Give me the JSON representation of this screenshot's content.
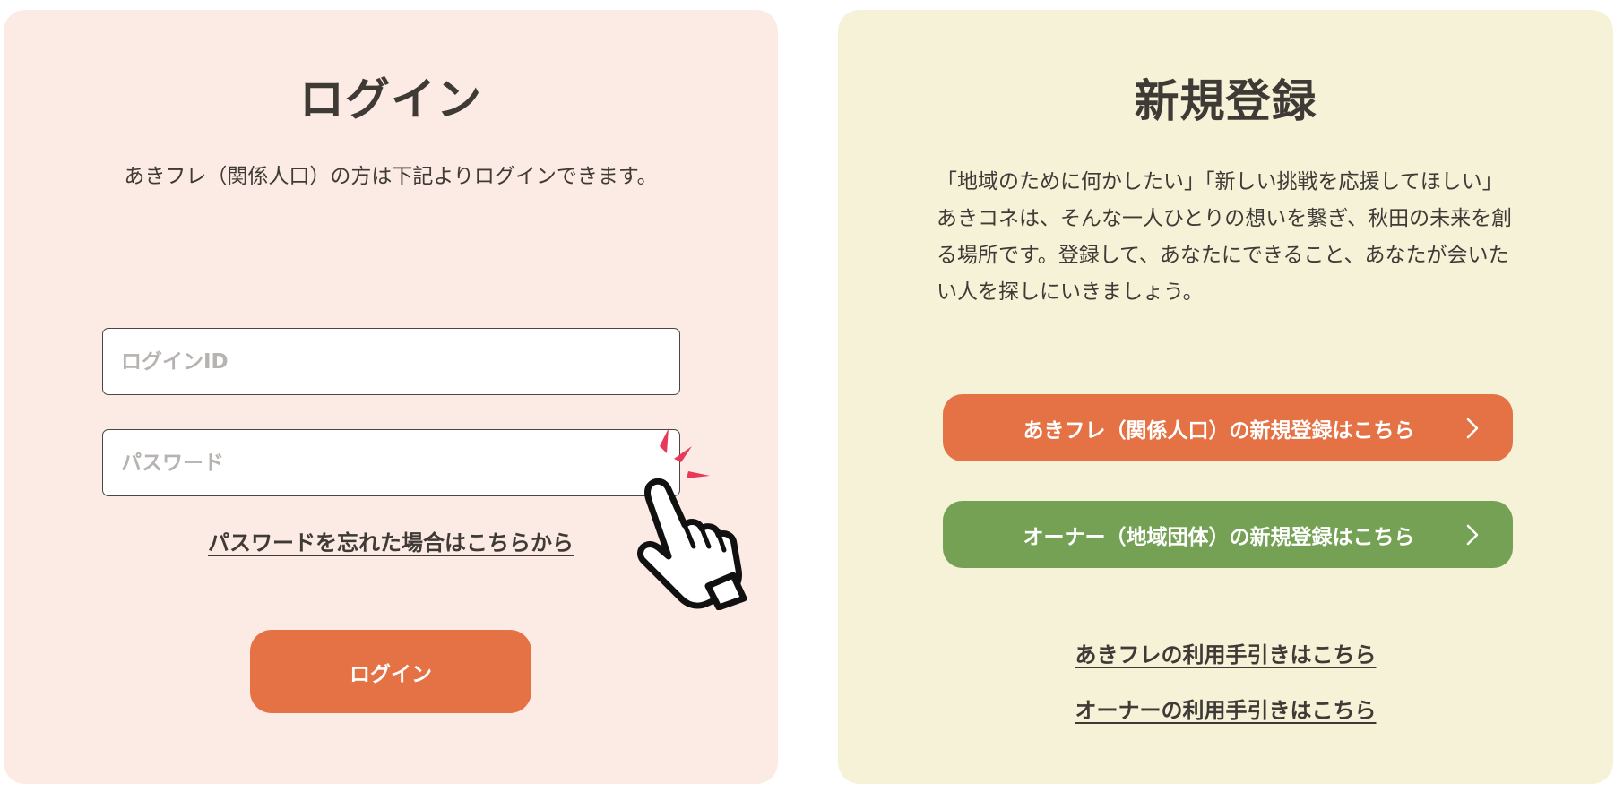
{
  "login": {
    "title": "ログイン",
    "description": "あきフレ（関係人口）の方は下記よりログインできます。",
    "id_placeholder": "ログインID",
    "password_placeholder": "パスワード",
    "forgot_link": "パスワードを忘れた場合はこちらから",
    "button_label": "ログイン",
    "pointer_icon": "hand-pointer-icon"
  },
  "register": {
    "title": "新規登録",
    "description": "「地域のために何かしたい」「新しい挑戦を応援してほしい」\nあきコネは、そんな一人ひとりの想いを繋ぎ、秋田の未来を創る場所です。登録して、あなたにできること、あなたが会いたい人を探しにいきましょう。",
    "akifure_button": "あきフレ（関係人口）の新規登録はこちら",
    "owner_button": "オーナー（地域団体）の新規登録はこちら",
    "akifure_guide": "あきフレの利用手引きはこちら",
    "owner_guide": "オーナーの利用手引きはこちら"
  },
  "colors": {
    "login_bg": "#fcebe4",
    "register_bg": "#f5f2d8",
    "accent_orange": "#e57245",
    "accent_green": "#74a154",
    "text": "#3f3a36",
    "sparkle": "#e8395a"
  }
}
